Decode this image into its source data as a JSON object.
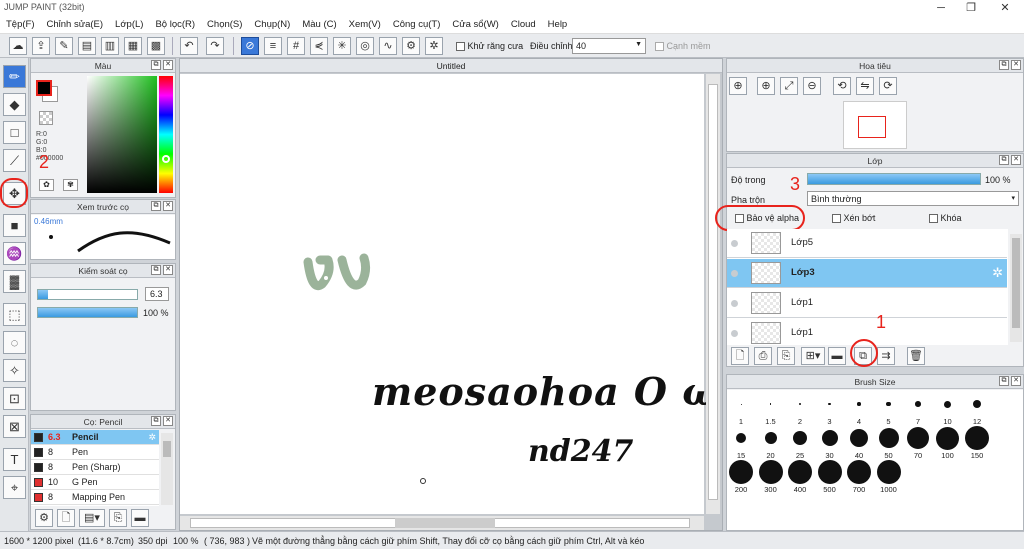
{
  "window": {
    "title": "JUMP PAINT (32bit)"
  },
  "menu": [
    "Tệp(F)",
    "Chỉnh sửa(E)",
    "Lớp(L)",
    "Bộ lọc(R)",
    "Chọn(S)",
    "Chụp(N)",
    "Màu (C)",
    "Xem(V)",
    "Công cụ(T)",
    "Cửa sổ(W)",
    "Cloud",
    "Help"
  ],
  "toolbar": {
    "antialias_label": "Khử răng cưa",
    "adjust_label": "Điều chỉnh",
    "adjust_value": "40",
    "snap_label": "Cạnh mềm"
  },
  "color_panel": {
    "title": "Màu",
    "r": "R:0",
    "g": "G:0",
    "b": "B:0",
    "hex": "#000000"
  },
  "brush_preview": {
    "title": "Xem trước cọ",
    "size": "0.46mm"
  },
  "brush_control": {
    "title": "Kiểm soát cọ",
    "size_value": "6.3",
    "opacity_value": "100 %",
    "size_fraction": 0.1,
    "opacity_fraction": 1.0
  },
  "brush_list": {
    "title": "Cọ: Pencil",
    "items": [
      {
        "size": "6.3",
        "name": "Pencil",
        "color": "#222222",
        "selected": true
      },
      {
        "size": "8",
        "name": "Pen",
        "color": "#222222",
        "selected": false
      },
      {
        "size": "8",
        "name": "Pen (Sharp)",
        "color": "#222222",
        "selected": false
      },
      {
        "size": "10",
        "name": "G Pen",
        "color": "#e03030",
        "selected": false
      },
      {
        "size": "8",
        "name": "Mapping Pen",
        "color": "#e03030",
        "selected": false
      }
    ]
  },
  "canvas": {
    "tab": "Untitled",
    "text1": "meosaohoa O ω O",
    "text2": "nd247"
  },
  "navigator": {
    "title": "Hoa tiêu"
  },
  "layer_panel": {
    "title": "Lớp",
    "opacity_label": "Độ trong",
    "opacity_value": "100 %",
    "blend_label": "Pha trộn",
    "blend_value": "Bình thường",
    "protect_alpha": "Bảo vệ alpha",
    "clip": "Xén bớt",
    "lock": "Khóa",
    "layers": [
      {
        "name": "Lớp5",
        "selected": false
      },
      {
        "name": "Lớp3",
        "selected": true
      },
      {
        "name": "Lớp1",
        "selected": false
      },
      {
        "name": "Lớp1",
        "selected": false
      }
    ]
  },
  "brush_size_panel": {
    "title": "Brush Size",
    "sizes": [
      "1",
      "1.5",
      "2",
      "3",
      "4",
      "5",
      "7",
      "10",
      "12",
      "15",
      "20",
      "25",
      "30",
      "40",
      "50",
      "70",
      "100",
      "150",
      "200",
      "300",
      "400",
      "500",
      "700",
      "1000"
    ]
  },
  "annotations": [
    "1",
    "2",
    "3"
  ],
  "status": {
    "size": "1600 * 1200 pixel",
    "cm": "(11.6 * 8.7cm)",
    "dpi": "350 dpi",
    "zoom": "100 %",
    "coords": "( 736, 983 )",
    "hint": "Vẽ một đường thẳng bằng cách giữ phím Shift, Thay đổi cỡ cọ bằng cách giữ phím Ctrl, Alt và kéo"
  }
}
